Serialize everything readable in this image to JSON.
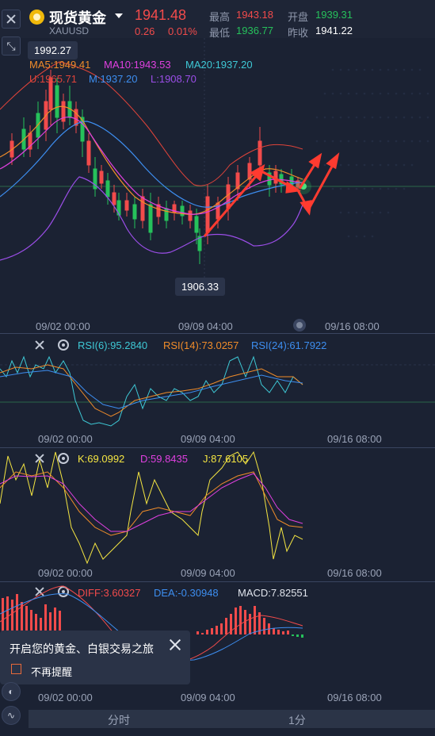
{
  "header": {
    "title": "现货黄金",
    "symbol": "XAUUSD",
    "price": "1941.48",
    "change": "0.26",
    "change_pct": "0.01%",
    "high_label": "最高",
    "high": "1943.18",
    "open_label": "开盘",
    "open": "1939.31",
    "low_label": "最低",
    "low": "1936.77",
    "prev_close_label": "昨收",
    "prev_close": "1941.22"
  },
  "main_chart": {
    "ma5": "MA5:1949.41",
    "ma10": "MA10:1943.53",
    "ma20": "MA20:1937.20",
    "boll_u": "U:1965.71",
    "boll_m": "M:1937.20",
    "boll_l": "L:1908.70",
    "max_label": "1992.27",
    "min_label": "1906.33",
    "x_ticks": [
      "09/02 00:00",
      "09/09 04:00",
      "09/16 08:00"
    ]
  },
  "rsi": {
    "rsi6": "RSI(6):95.2840",
    "rsi14": "RSI(14):73.0257",
    "rsi24": "RSI(24):61.7922",
    "x_ticks": [
      "09/02 00:00",
      "09/09 04:00",
      "09/16 08:00"
    ]
  },
  "kdj": {
    "k": "K:69.0992",
    "d": "D:59.8435",
    "j": "J:87.6105",
    "x_ticks": [
      "09/02 00:00",
      "09/09 04:00",
      "09/16 08:00"
    ]
  },
  "macd": {
    "diff": "DIFF:3.60327",
    "dea": "DEA:-0.30948",
    "macd": "MACD:7.82551",
    "x_ticks": [
      "09/02 00:00",
      "09/09 04:00",
      "09/16 08:00"
    ]
  },
  "popup": {
    "text": "开启您的黄金、白银交易之旅",
    "checkbox_label": "不再提醒"
  },
  "bottom_bar": {
    "tab_timeshare": "分时",
    "tab_1min": "1分"
  },
  "colors": {
    "up": "#f24b4b",
    "down": "#26c15b",
    "ma5": "#f08c2a",
    "ma10": "#e040e0",
    "ma20": "#3ec9d6",
    "boll_u": "#e0443a",
    "boll_m": "#3d8ef0",
    "boll_l": "#9b4ee8",
    "kdj_j": "#f5e642"
  }
}
